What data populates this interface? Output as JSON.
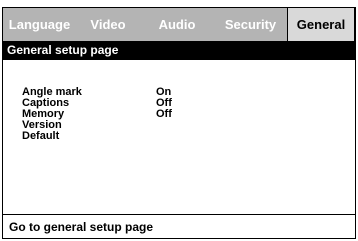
{
  "tabs": [
    {
      "label": "Language",
      "active": false
    },
    {
      "label": "Video",
      "active": false
    },
    {
      "label": "Audio",
      "active": false
    },
    {
      "label": "Security",
      "active": false
    },
    {
      "label": "General",
      "active": true
    }
  ],
  "header": {
    "title": "General setup page"
  },
  "settings": [
    {
      "label": "Angle mark",
      "value": "On"
    },
    {
      "label": "Captions",
      "value": "Off"
    },
    {
      "label": "Memory",
      "value": "Off"
    },
    {
      "label": "Version",
      "value": ""
    },
    {
      "label": "Default",
      "value": ""
    }
  ],
  "status": {
    "text": "Go to general setup page"
  },
  "colors": {
    "tab_bar": "#b4b4b4",
    "active_tab": "#d9d9d9",
    "header_bg": "#000000",
    "tab_text": "#ffffff"
  }
}
